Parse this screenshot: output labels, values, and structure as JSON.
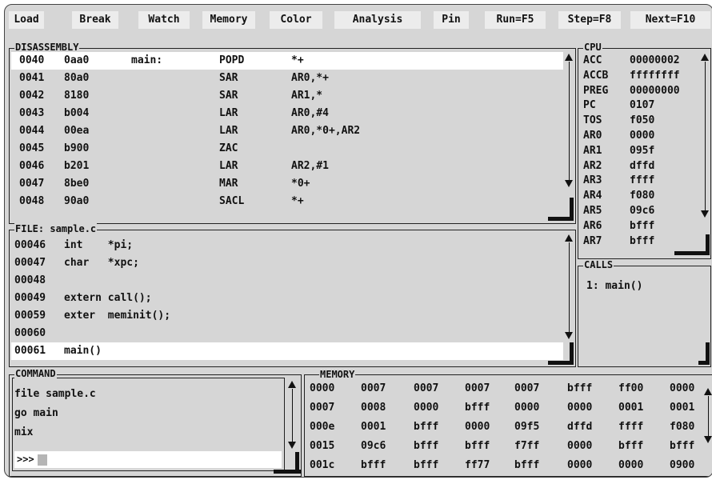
{
  "menu": [
    {
      "label": "Load"
    },
    {
      "label": "Break"
    },
    {
      "label": "Watch"
    },
    {
      "label": "Memory"
    },
    {
      "label": "Color"
    },
    {
      "label": "Analysis"
    },
    {
      "label": "Pin"
    },
    {
      "label": "Run=F5"
    },
    {
      "label": "Step=F8"
    },
    {
      "label": "Next=F10"
    }
  ],
  "disassembly": {
    "title": "DISASSEMBLY",
    "rows": [
      {
        "addr": "0040",
        "op": "0aa0",
        "label": "main:",
        "mnem": "POPD",
        "args": "*+"
      },
      {
        "addr": "0041",
        "op": "80a0",
        "label": "",
        "mnem": "SAR",
        "args": "AR0,*+"
      },
      {
        "addr": "0042",
        "op": "8180",
        "label": "",
        "mnem": "SAR",
        "args": "AR1,*"
      },
      {
        "addr": "0043",
        "op": "b004",
        "label": "",
        "mnem": "LAR",
        "args": "AR0,#4"
      },
      {
        "addr": "0044",
        "op": "00ea",
        "label": "",
        "mnem": "LAR",
        "args": "AR0,*0+,AR2"
      },
      {
        "addr": "0045",
        "op": "b900",
        "label": "",
        "mnem": "ZAC",
        "args": ""
      },
      {
        "addr": "0046",
        "op": "b201",
        "label": "",
        "mnem": "LAR",
        "args": "AR2,#1"
      },
      {
        "addr": "0047",
        "op": "8be0",
        "label": "",
        "mnem": "MAR",
        "args": "*0+"
      },
      {
        "addr": "0048",
        "op": "90a0",
        "label": "",
        "mnem": "SACL",
        "args": "*+"
      }
    ]
  },
  "file": {
    "title": "FILE: sample.c",
    "rows": [
      {
        "line": "00046",
        "code": "int    *pi;"
      },
      {
        "line": "00047",
        "code": "char   *xpc;"
      },
      {
        "line": "00048",
        "code": ""
      },
      {
        "line": "00049",
        "code": "extern call();"
      },
      {
        "line": "00059",
        "code": "exter  meminit();"
      },
      {
        "line": "00060",
        "code": ""
      },
      {
        "line": "00061",
        "code": "main()"
      }
    ]
  },
  "cpu": {
    "title": "CPU",
    "registers": [
      {
        "name": "ACC",
        "value": "00000002"
      },
      {
        "name": "ACCB",
        "value": "ffffffff"
      },
      {
        "name": "PREG",
        "value": "00000000"
      },
      {
        "name": "PC",
        "value": "0107"
      },
      {
        "name": "TOS",
        "value": "f050"
      },
      {
        "name": "AR0",
        "value": "0000"
      },
      {
        "name": "AR1",
        "value": "095f"
      },
      {
        "name": "AR2",
        "value": "dffd"
      },
      {
        "name": "AR3",
        "value": "ffff"
      },
      {
        "name": "AR4",
        "value": "f080"
      },
      {
        "name": "AR5",
        "value": "09c6"
      },
      {
        "name": "AR6",
        "value": "bfff"
      },
      {
        "name": "AR7",
        "value": "bfff"
      }
    ]
  },
  "calls": {
    "title": "CALLS",
    "items": [
      {
        "text": "1: main()"
      }
    ]
  },
  "command": {
    "title": "COMMAND",
    "history": [
      {
        "text": "file sample.c"
      },
      {
        "text": "go main"
      },
      {
        "text": "mix"
      }
    ],
    "prompt": ">>>"
  },
  "memory": {
    "title": "MEMORY",
    "rows": [
      [
        "0000",
        "0007",
        "0007",
        "0007",
        "0007",
        "bfff",
        "ff00",
        "0000"
      ],
      [
        "0007",
        "0008",
        "0000",
        "bfff",
        "0000",
        "0000",
        "0001",
        "0001"
      ],
      [
        "000e",
        "0001",
        "bfff",
        "0000",
        "09f5",
        "dffd",
        "ffff",
        "f080"
      ],
      [
        "0015",
        "09c6",
        "bfff",
        "bfff",
        "f7ff",
        "0000",
        "bfff",
        "bfff"
      ],
      [
        "001c",
        "bfff",
        "bfff",
        "ff77",
        "bfff",
        "0000",
        "0000",
        "0900"
      ]
    ]
  }
}
